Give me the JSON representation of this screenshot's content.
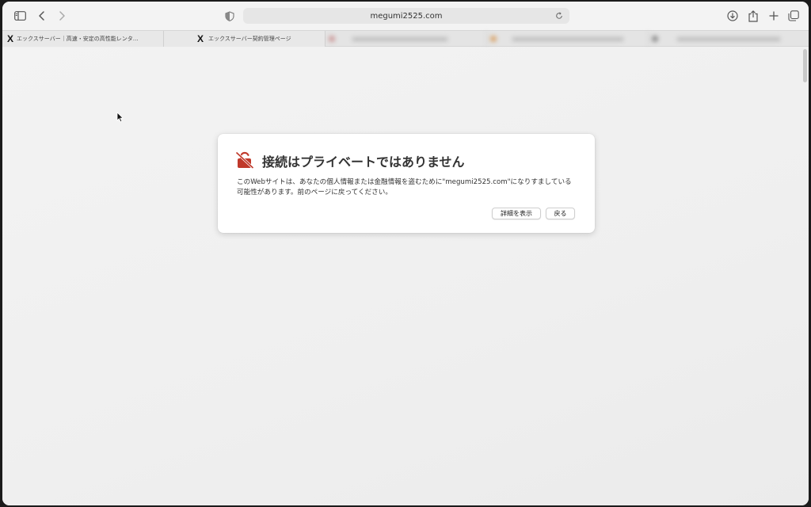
{
  "browser": {
    "address_url": "megumi2525.com",
    "tabs": [
      {
        "favicon": "X",
        "label": "エックスサーバー｜高速・安定の高性能レンタ…"
      },
      {
        "favicon": "X",
        "label": "エックスサーバー契約管理ページ"
      }
    ],
    "icons": {
      "sidebar": "sidebar-icon",
      "back": "chevron-left-icon",
      "forward": "chevron-right-icon",
      "privacy": "shield-icon",
      "reload": "reload-icon",
      "download": "download-icon",
      "share": "share-icon",
      "new_tab": "plus-icon",
      "tab_overview": "tabs-icon"
    }
  },
  "dialog": {
    "title": "接続はプライベートではありません",
    "body": "このWebサイトは、あなたの個人情報または金融情報を盗むために\"megumi2525.com\"になりすましている可能性があります。前のページに戻ってください。",
    "details_button": "詳細を表示",
    "back_button": "戻る",
    "icon": "broken-lock-icon",
    "accent_color": "#c0392b"
  }
}
